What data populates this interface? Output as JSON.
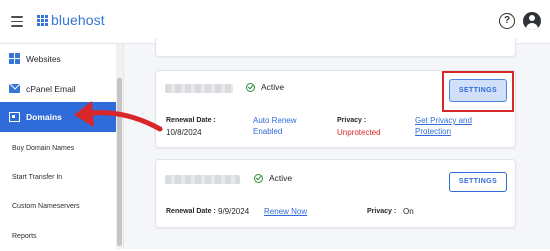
{
  "brand": {
    "name": "bluehost"
  },
  "header": {
    "help_icon": "question-circle-icon",
    "avatar_icon": "user-circle-icon",
    "help_glyph": "?"
  },
  "sidebar": {
    "items": [
      {
        "label": "Websites",
        "icon": "grid-icon"
      },
      {
        "label": "cPanel Email",
        "icon": "mail-icon"
      },
      {
        "label": "Domains",
        "icon": "domain-icon",
        "active": true
      }
    ],
    "sub_items": [
      {
        "label": "Buy Domain Names"
      },
      {
        "label": "Start Transfer In"
      },
      {
        "label": "Custom Nameservers"
      },
      {
        "label": "Reports"
      }
    ]
  },
  "domains": [
    {
      "status": "Active",
      "renewal_label": "Renewal Date :",
      "renewal_value": "10/8/2024",
      "auto_renew_line1": "Auto Renew",
      "auto_renew_line2": "Enabled",
      "privacy_label": "Privacy :",
      "privacy_value": "Unprotected",
      "privacy_link_line1": "Get Privacy and",
      "privacy_link_line2": "Protection",
      "button": "SETTINGS"
    },
    {
      "status": "Active",
      "renewal_label": "Renewal Date :",
      "renewal_value": "9/9/2024",
      "renew_link": "Renew Now",
      "privacy_label": "Privacy :",
      "privacy_value": "On",
      "button": "SETTINGS"
    }
  ],
  "colors": {
    "brand": "#3575d3",
    "active_nav": "#2f6bd9",
    "annotation": "#d8262b",
    "success": "#2e8b3a",
    "danger": "#d6272b"
  }
}
